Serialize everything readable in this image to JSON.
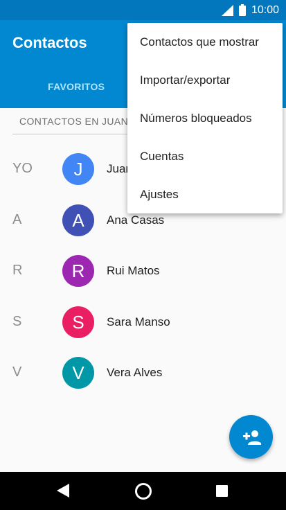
{
  "status_bar": {
    "time": "10:00",
    "icons": [
      "signal-icon",
      "battery-icon"
    ]
  },
  "app_bar": {
    "title": "Contactos",
    "tabs": [
      {
        "label": "FAVORITOS"
      }
    ]
  },
  "account": {
    "label": "CONTACTOS EN JUAN"
  },
  "contacts": [
    {
      "section": "YO",
      "initial": "J",
      "name": "Juan",
      "color": "#4285f4"
    },
    {
      "section": "A",
      "initial": "A",
      "name": "Ana Casas",
      "color": "#3f51b5"
    },
    {
      "section": "R",
      "initial": "R",
      "name": "Rui Matos",
      "color": "#9c27b0"
    },
    {
      "section": "S",
      "initial": "S",
      "name": "Sara Manso",
      "color": "#e91e63"
    },
    {
      "section": "V",
      "initial": "V",
      "name": "Vera Alves",
      "color": "#0097a7"
    }
  ],
  "overflow_menu": {
    "items": [
      {
        "label": "Contactos que mostrar"
      },
      {
        "label": "Importar/exportar"
      },
      {
        "label": "Números bloqueados"
      },
      {
        "label": "Cuentas"
      },
      {
        "label": "Ajustes"
      }
    ]
  },
  "fab": {
    "icon": "add-person-icon"
  },
  "nav_bar": {
    "icons": [
      "back-icon",
      "home-icon",
      "recents-icon"
    ]
  },
  "colors": {
    "primary": "#0288d1",
    "primary_dark": "#0277bd"
  }
}
